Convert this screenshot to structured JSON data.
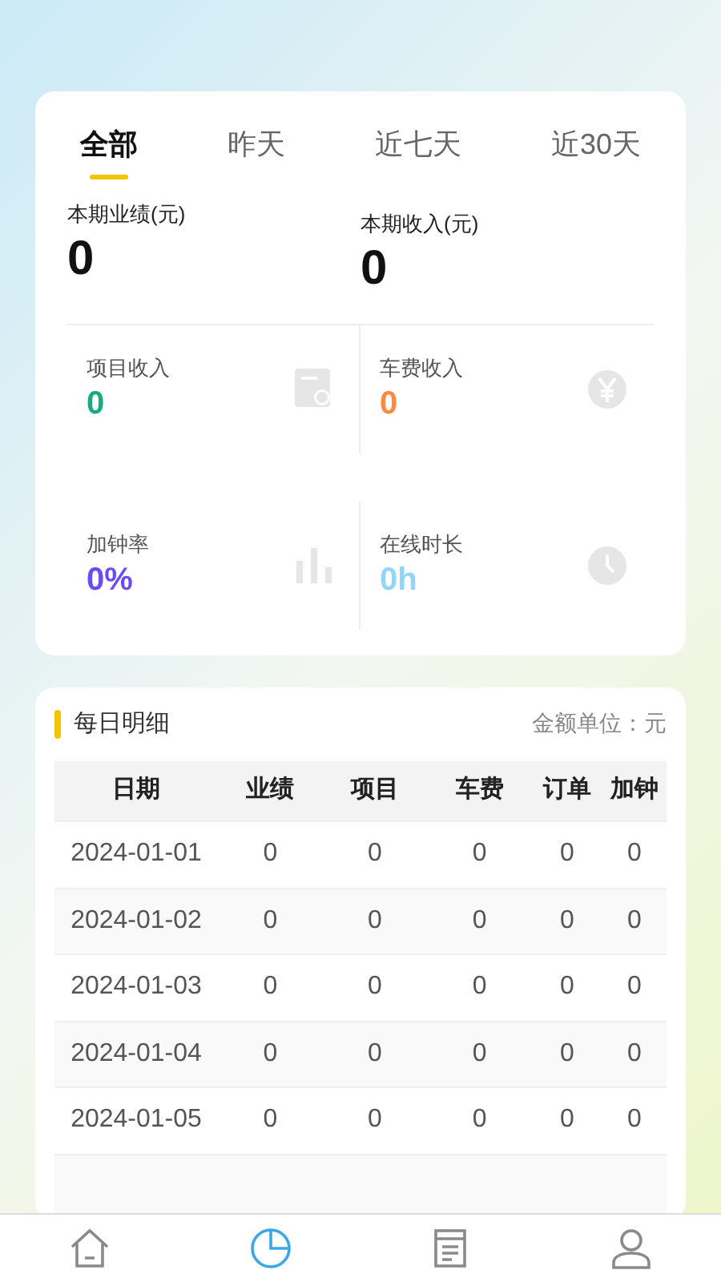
{
  "tabs": [
    {
      "label": "全部",
      "selected": true
    },
    {
      "label": "昨天",
      "selected": false
    },
    {
      "label": "近七天",
      "selected": false
    },
    {
      "label": "近30天",
      "selected": false
    }
  ],
  "totals": [
    {
      "label": "本期业绩(元)",
      "value": "0"
    },
    {
      "label": "本期收入(元)",
      "value": "0"
    }
  ],
  "stats": [
    {
      "label": "项目收入",
      "value": "0",
      "color": "#1aaa7f"
    },
    {
      "label": "车费收入",
      "value": "0",
      "color": "#ff8a3d"
    },
    {
      "label": "加钟率",
      "value": "0%",
      "color": "#6a4cf5"
    },
    {
      "label": "在线时长",
      "value": "0h",
      "color": "#8fd6ff"
    }
  ],
  "daily": {
    "title": "每日明细",
    "unit": "金额单位：元",
    "columns": [
      "日期",
      "业绩",
      "项目",
      "车费",
      "订单",
      "加钟"
    ],
    "rows": [
      [
        "2024-01-01",
        "0",
        "0",
        "0",
        "0",
        "0"
      ],
      [
        "2024-01-02",
        "0",
        "0",
        "0",
        "0",
        "0"
      ],
      [
        "2024-01-03",
        "0",
        "0",
        "0",
        "0",
        "0"
      ],
      [
        "2024-01-04",
        "0",
        "0",
        "0",
        "0",
        "0"
      ],
      [
        "2024-01-05",
        "0",
        "0",
        "0",
        "0",
        "0"
      ]
    ]
  },
  "nav": [
    {
      "selected": false
    },
    {
      "selected": true
    },
    {
      "selected": false
    },
    {
      "selected": false
    }
  ]
}
